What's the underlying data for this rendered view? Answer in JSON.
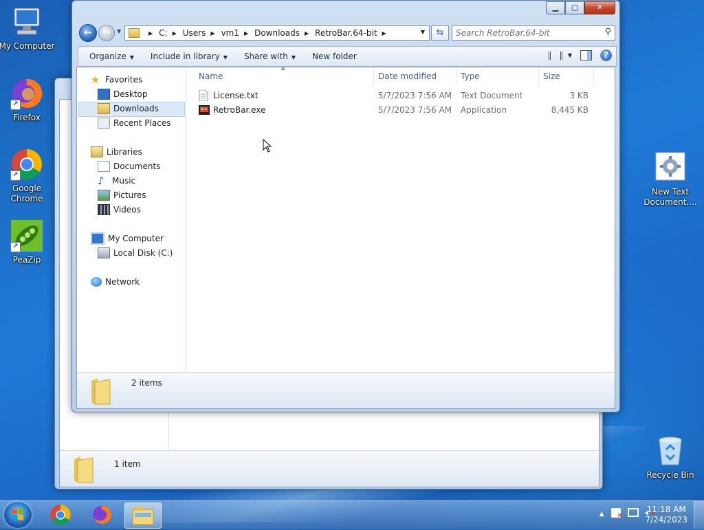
{
  "desktop": {
    "icons": [
      {
        "label": "My Computer"
      },
      {
        "label": "Firefox"
      },
      {
        "label": "Google Chrome"
      },
      {
        "label": "PeaZip"
      },
      {
        "label": "New Text Document...."
      },
      {
        "label": "Recycle Bin"
      }
    ]
  },
  "explorer": {
    "address": [
      "C:",
      "Users",
      "vm1",
      "Downloads",
      "RetroBar.64-bit"
    ],
    "search_placeholder": "Search RetroBar.64-bit",
    "toolbar": {
      "organize": "Organize",
      "include_in_library": "Include in library",
      "share_with": "Share with",
      "new_folder": "New folder"
    },
    "nav_pane": {
      "favorites": "Favorites",
      "desktop": "Desktop",
      "downloads": "Downloads",
      "recent_places": "Recent Places",
      "libraries": "Libraries",
      "documents": "Documents",
      "music": "Music",
      "pictures": "Pictures",
      "videos": "Videos",
      "my_computer": "My Computer",
      "local_disk": "Local Disk (C:)",
      "network": "Network"
    },
    "columns": {
      "name": "Name",
      "date_modified": "Date modified",
      "type": "Type",
      "size": "Size"
    },
    "files": [
      {
        "name": "License.txt",
        "date": "5/7/2023 7:56 AM",
        "type": "Text Document",
        "size": "3 KB",
        "icon": "text-file-icon"
      },
      {
        "name": "RetroBar.exe",
        "date": "5/7/2023 7:56 AM",
        "type": "Application",
        "size": "8,445 KB",
        "icon": "application-icon"
      }
    ],
    "status": "2 items"
  },
  "back_window": {
    "status": "1 item"
  },
  "taskbar": {
    "time": "11:18 AM",
    "date": "7/24/2023"
  },
  "colors": {
    "accent": "#1f5fb8",
    "selection": "#dce9f8"
  }
}
